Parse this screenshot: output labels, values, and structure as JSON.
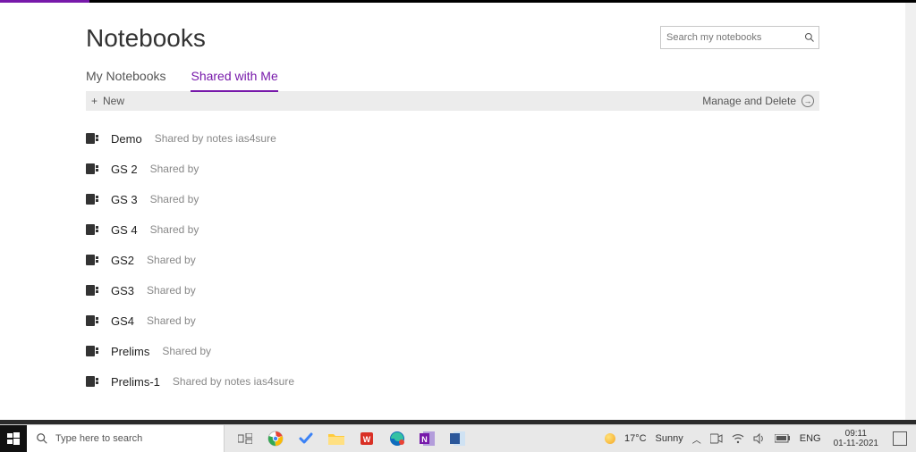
{
  "page_title": "Notebooks",
  "search_placeholder": "Search my notebooks",
  "tabs": {
    "my": "My Notebooks",
    "shared": "Shared with Me"
  },
  "actions": {
    "new_label": "New",
    "manage_label": "Manage and Delete"
  },
  "notebooks": [
    {
      "name": "Demo",
      "shared": "Shared by notes ias4sure"
    },
    {
      "name": "GS 2",
      "shared": "Shared by"
    },
    {
      "name": "GS 3",
      "shared": "Shared by"
    },
    {
      "name": "GS 4",
      "shared": "Shared by"
    },
    {
      "name": "GS2",
      "shared": "Shared by"
    },
    {
      "name": "GS3",
      "shared": "Shared by"
    },
    {
      "name": "GS4",
      "shared": "Shared by"
    },
    {
      "name": "Prelims",
      "shared": "Shared by"
    },
    {
      "name": "Prelims-1",
      "shared": "Shared by notes ias4sure"
    }
  ],
  "taskbar": {
    "search_placeholder": "Type here to search",
    "weather_temp": "17°C",
    "weather_cond": "Sunny",
    "lang": "ENG",
    "time": "09:11",
    "date": "01-11-2021"
  }
}
